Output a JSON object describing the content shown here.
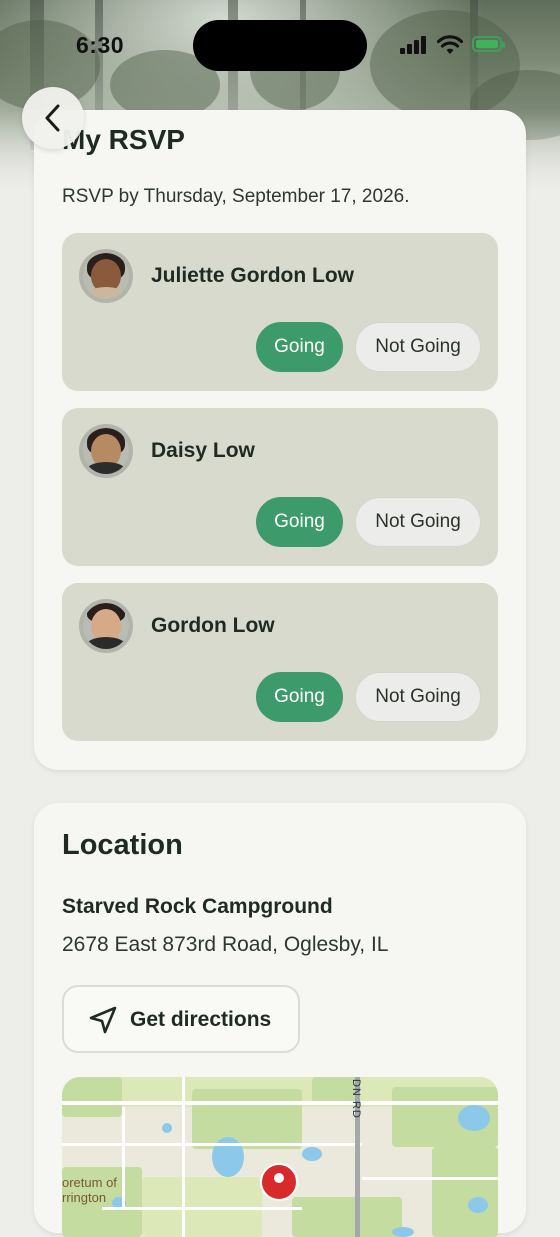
{
  "status_bar": {
    "time": "6:30"
  },
  "rsvp": {
    "title": "My RSVP",
    "deadline": "RSVP by Thursday, September 17, 2026.",
    "going_label": "Going",
    "not_going_label": "Not Going",
    "people": [
      {
        "name": "Juliette Gordon Low",
        "status": "Going"
      },
      {
        "name": "Daisy Low",
        "status": "Going"
      },
      {
        "name": "Gordon Low",
        "status": "Going"
      }
    ]
  },
  "location": {
    "title": "Location",
    "name": "Starved Rock Campground",
    "address": "2678 East 873rd Road, Oglesby, IL",
    "directions_label": "Get directions",
    "map": {
      "place_label_1": "oretum of",
      "place_label_2": "rrington",
      "road_label": "DN RD"
    }
  },
  "colors": {
    "accent_green": "#3d9a6a",
    "card_bg": "#f6f6f2",
    "person_bg": "#d8dace",
    "page_bg": "#ededea"
  },
  "icons": {
    "back": "chevron-left-icon",
    "directions": "navigation-arrow-icon",
    "map_pin": "map-pin-icon"
  }
}
